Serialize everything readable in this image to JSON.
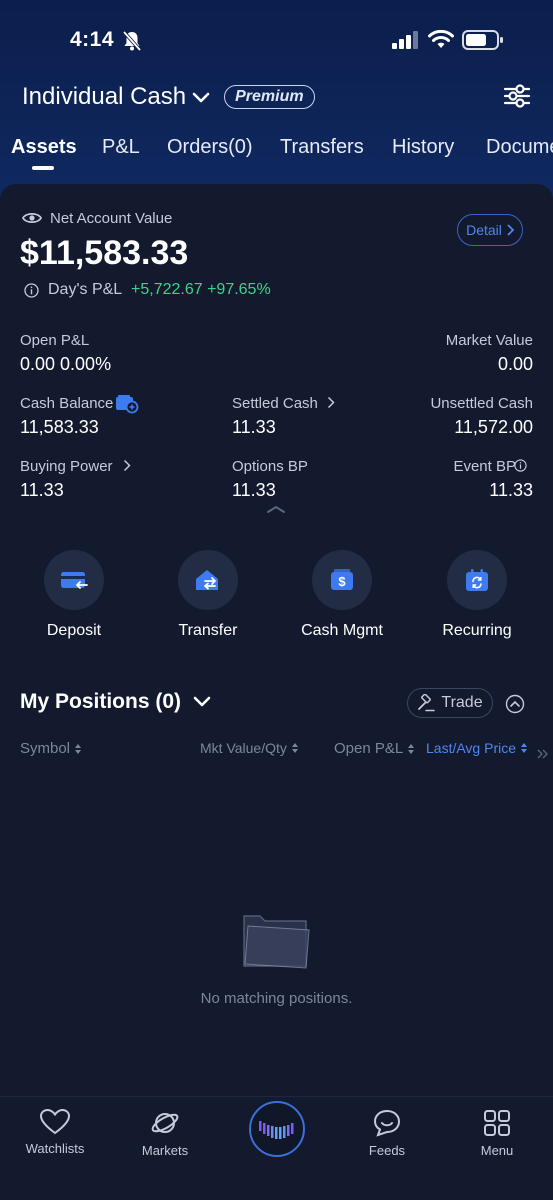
{
  "status_bar": {
    "time": "4:14"
  },
  "header": {
    "account_name": "Individual Cash",
    "badge": "Premium"
  },
  "tabs": [
    {
      "label": "Assets",
      "active": true
    },
    {
      "label": "P&L"
    },
    {
      "label": "Orders(0)"
    },
    {
      "label": "Transfers"
    },
    {
      "label": "History"
    },
    {
      "label": "Documents"
    }
  ],
  "summary": {
    "net_label": "Net Account Value",
    "net_value": "$11,583.33",
    "detail_label": "Detail",
    "days_pl_label": "Day's P&L",
    "days_pl_value": "+5,722.67 +97.65%"
  },
  "metrics": {
    "open_pl": {
      "label": "Open P&L",
      "value": "0.00 0.00%"
    },
    "market_value": {
      "label": "Market Value",
      "value": "0.00"
    },
    "cash_balance": {
      "label": "Cash Balance",
      "value": "11,583.33"
    },
    "settled_cash": {
      "label": "Settled Cash",
      "value": "11.33"
    },
    "unsettled_cash": {
      "label": "Unsettled Cash",
      "value": "11,572.00"
    },
    "buying_power": {
      "label": "Buying Power",
      "value": "11.33"
    },
    "options_bp": {
      "label": "Options BP",
      "value": "11.33"
    },
    "event_bp": {
      "label": "Event BP",
      "value": "11.33"
    }
  },
  "actions": [
    {
      "label": "Deposit",
      "icon": "deposit-icon"
    },
    {
      "label": "Transfer",
      "icon": "transfer-icon"
    },
    {
      "label": "Cash Mgmt",
      "icon": "cash-mgmt-icon"
    },
    {
      "label": "Recurring",
      "icon": "recurring-icon"
    }
  ],
  "positions": {
    "title": "My Positions (0)",
    "trade_label": "Trade",
    "columns": [
      "Symbol",
      "Mkt Value/Qty",
      "Open P&L",
      "Last/Avg Price"
    ],
    "empty_text": "No matching positions."
  },
  "bottom_nav": [
    {
      "label": "Watchlists",
      "icon": "heart-icon"
    },
    {
      "label": "Markets",
      "icon": "planet-icon"
    },
    {
      "label": "Feeds",
      "icon": "chat-icon"
    },
    {
      "label": "Menu",
      "icon": "grid-icon"
    }
  ],
  "colors": {
    "accent": "#4f86f2",
    "positive": "#3fd38a",
    "background": "#131a2e",
    "header": "#0f2960"
  }
}
